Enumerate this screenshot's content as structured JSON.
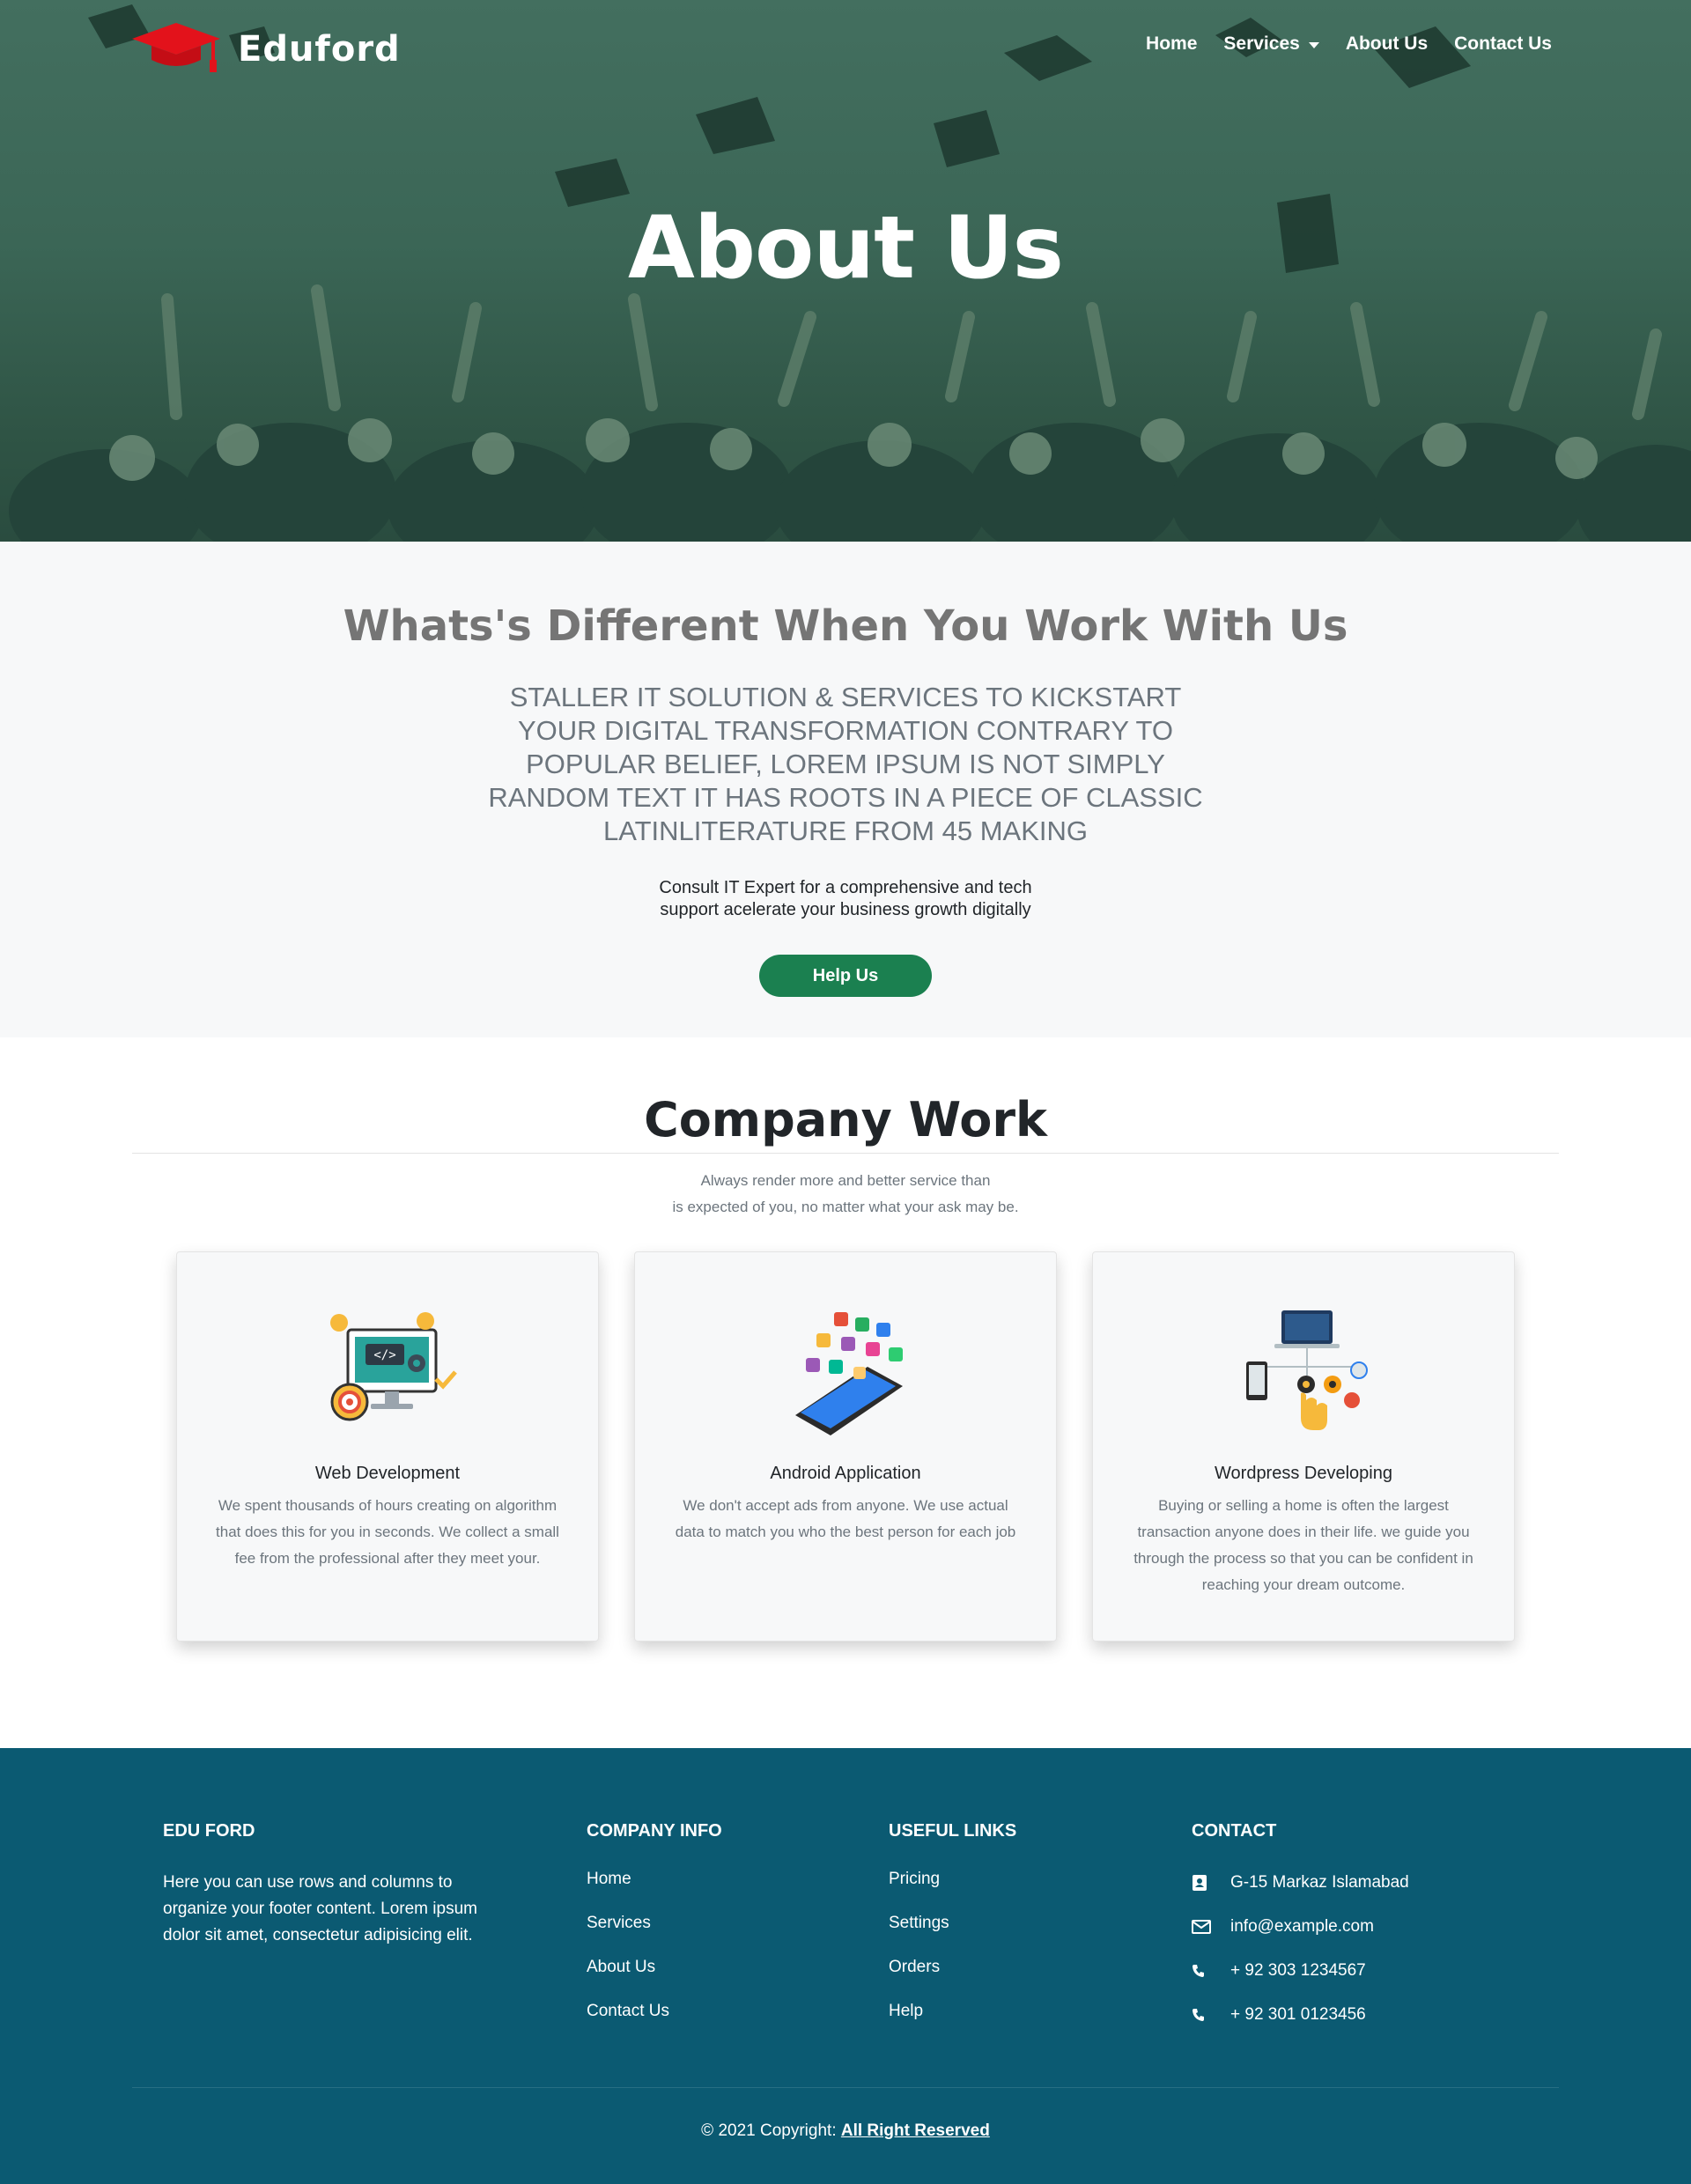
{
  "navbar": {
    "brand": "Eduford",
    "links": [
      {
        "label": "Home"
      },
      {
        "label": "Services",
        "dropdown": true
      },
      {
        "label": "About Us"
      },
      {
        "label": "Contact Us"
      }
    ]
  },
  "hero": {
    "title": "About Us"
  },
  "different": {
    "title": "Whats's Different When You Work With Us",
    "lead": "STALLER IT SOLUTION & SERVICES TO KICKSTART YOUR DIGITAL TRANSFORMATION CONTRARY TO POPULAR BELIEF, LOREM IPSUM IS NOT SIMPLY RANDOM TEXT IT HAS ROOTS IN A PIECE OF CLASSIC LATINLITERATURE FROM 45 MAKING",
    "subtitle": "Consult IT Expert for a comprehensive and tech support acelerate your business growth digitally",
    "button": "Help Us"
  },
  "work": {
    "title": "Company Work",
    "subtitle_line1": "Always render more and better service than",
    "subtitle_line2": "is expected of you, no matter what your ask may be.",
    "cards": [
      {
        "title": "Web Development",
        "text": "We spent thousands of hours creating on algorithm that does this for you in seconds. We collect a small fee from the professional after they meet your.",
        "icon": "web-development-illustration"
      },
      {
        "title": "Android Application",
        "text": "We don't accept ads from anyone. We use actual data to match you who the best person for each job",
        "icon": "android-app-illustration"
      },
      {
        "title": "Wordpress Developing",
        "text": "Buying or selling a home is often the largest transaction anyone does in their life. we guide you through the process so that you can be confident in reaching your dream outcome.",
        "icon": "wordpress-illustration"
      }
    ]
  },
  "footer": {
    "about": {
      "heading": "EDU FORD",
      "text": "Here you can use rows and columns to organize your footer content. Lorem ipsum dolor sit amet, consectetur adipisicing elit."
    },
    "company_info": {
      "heading": "COMPANY INFO",
      "links": [
        "Home",
        "Services",
        "About Us",
        "Contact Us"
      ]
    },
    "useful_links": {
      "heading": "USEFUL LINKS",
      "links": [
        "Pricing",
        "Settings",
        "Orders",
        "Help"
      ]
    },
    "contact": {
      "heading": "CONTACT",
      "address": "G-15 Markaz Islamabad",
      "email": "info@example.com",
      "phone1": "+ 92 303 1234567",
      "phone2": "+ 92 301 0123456"
    },
    "copyright_prefix": "© 2021 Copyright:",
    "copyright_link": "All Right Reserved"
  },
  "colors": {
    "hero_overlay": "#3b6656",
    "brand_cap": "#e3121b",
    "section_bg": "#f7f8f9",
    "button": "#1b8050",
    "footer": "#0b5a72"
  }
}
